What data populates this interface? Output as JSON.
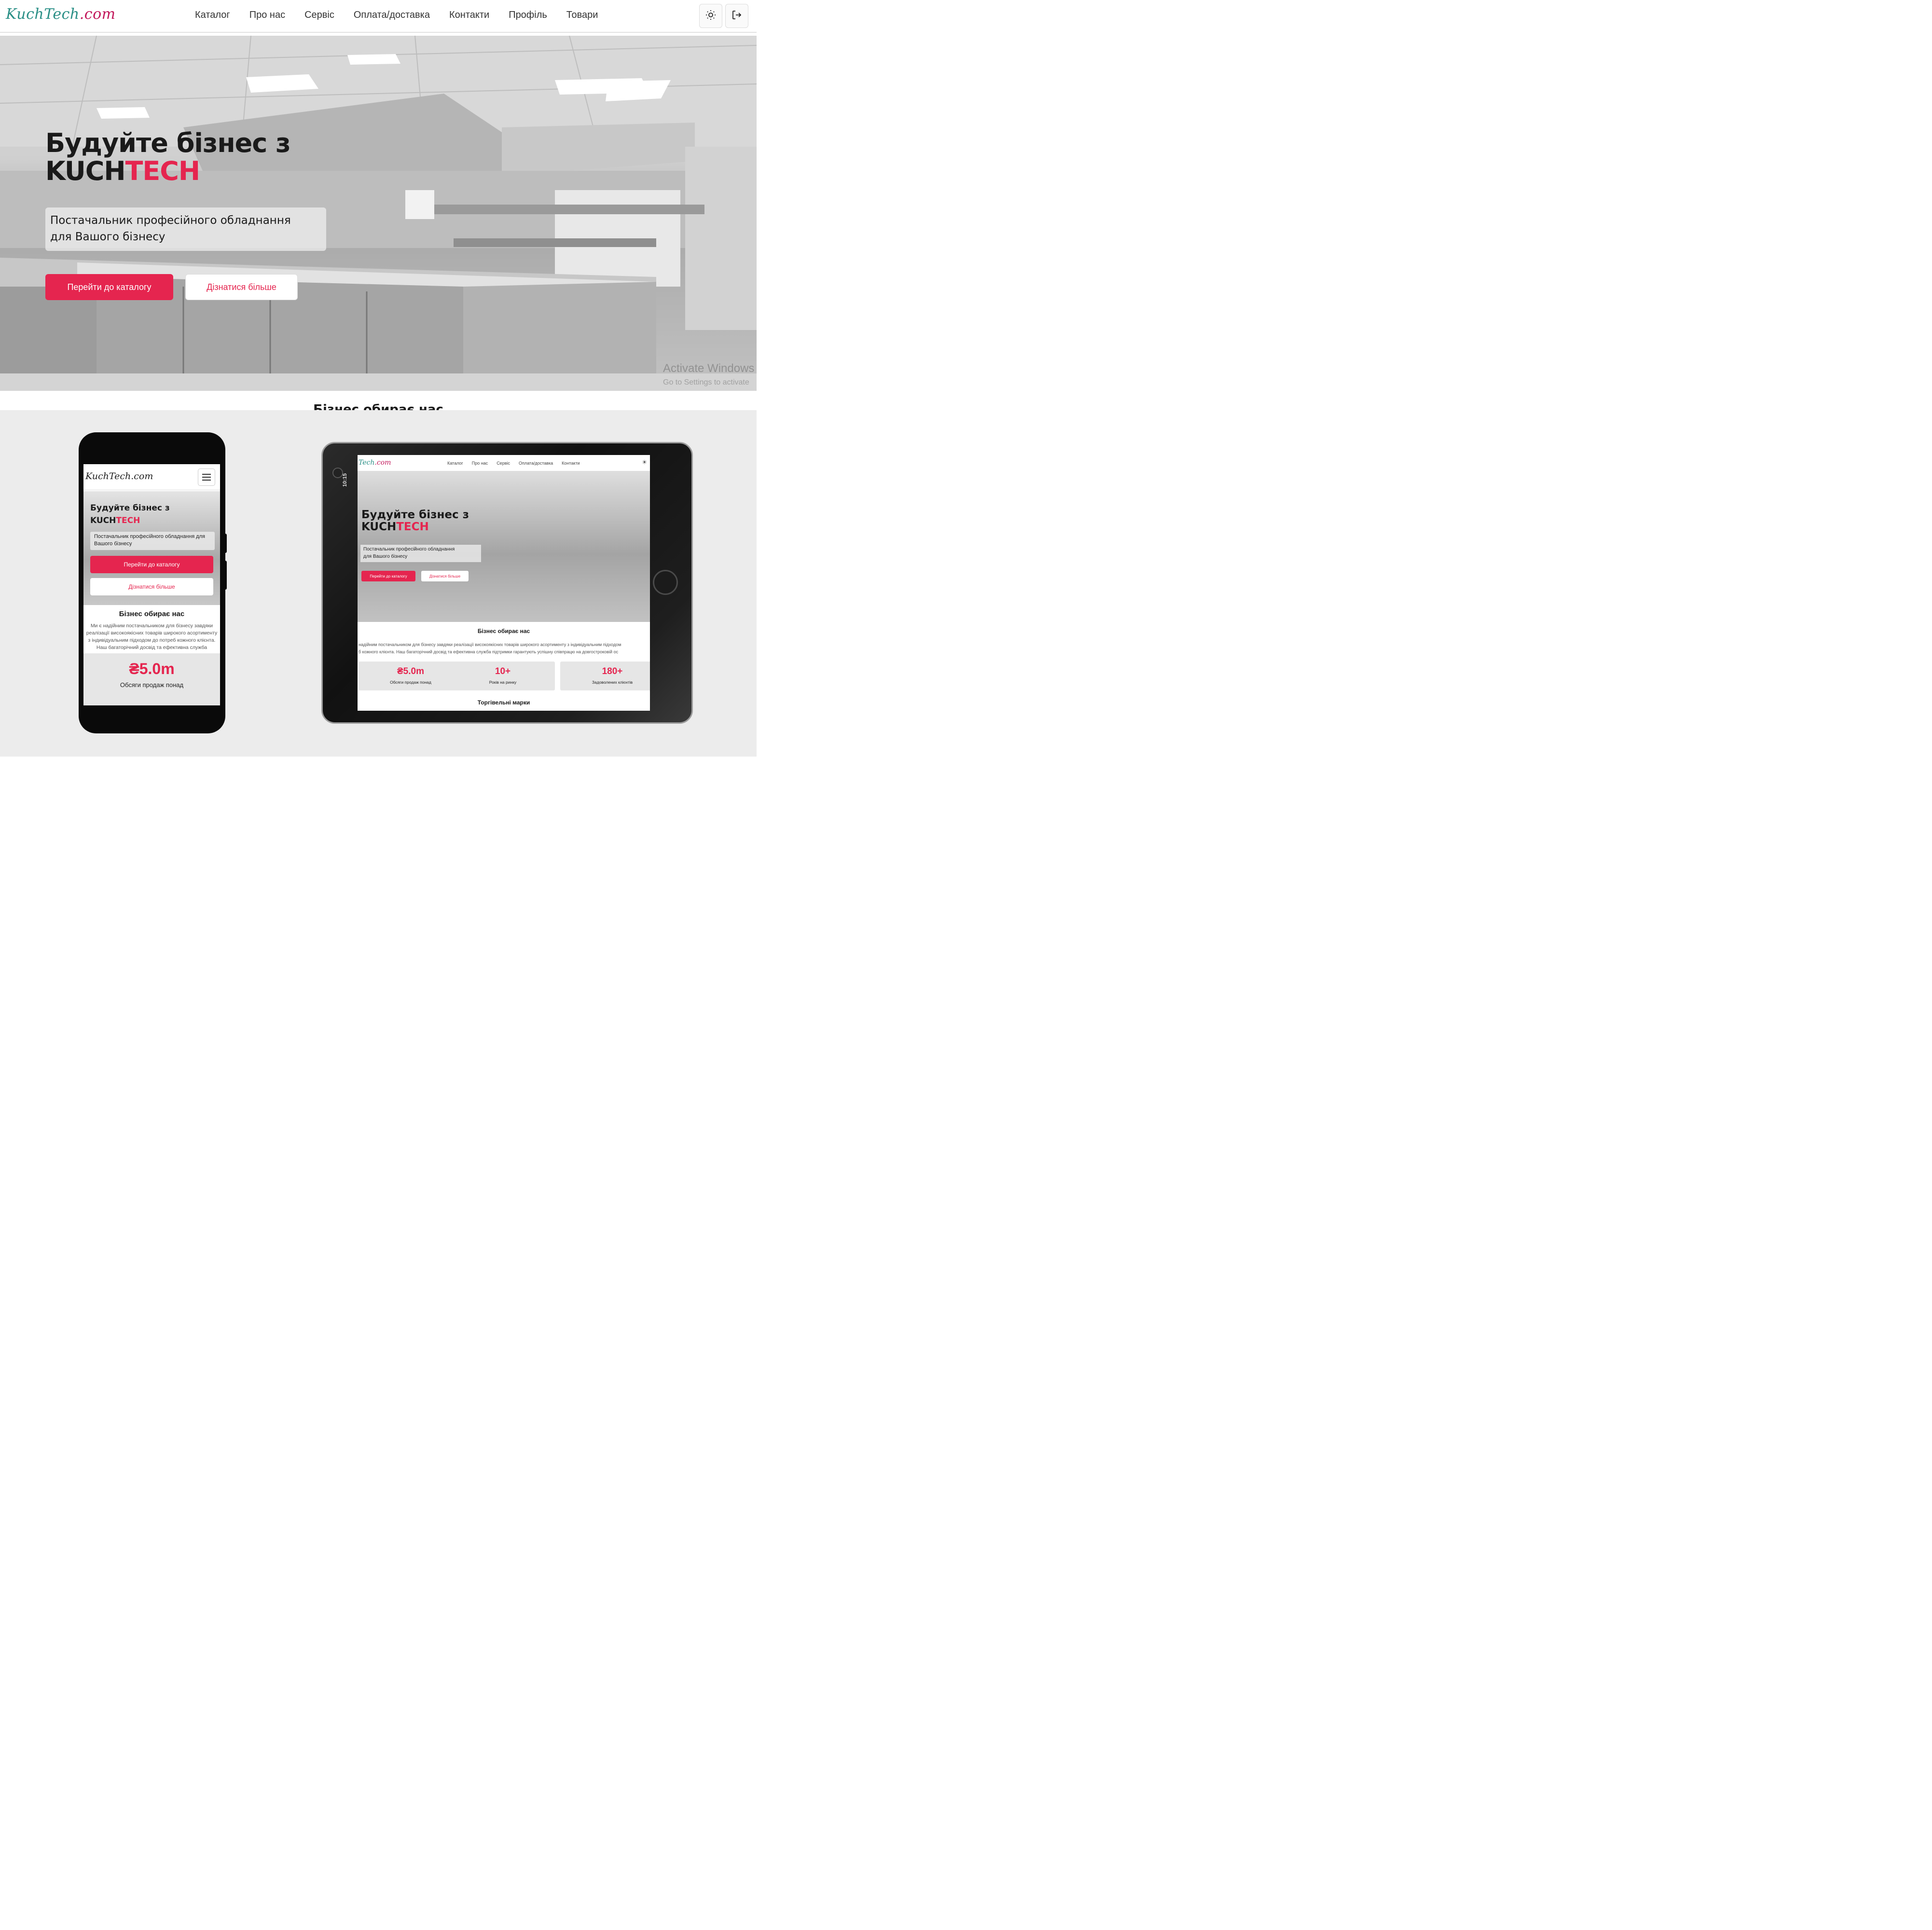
{
  "site": {
    "logo_part1": "KuchTech",
    "logo_part2": ".com",
    "nav": [
      "Каталог",
      "Про нас",
      "Сервіс",
      "Оплата/доставка",
      "Контакти",
      "Профіль",
      "Товари"
    ],
    "icons": {
      "theme": "sun-icon",
      "logout": "logout-icon"
    }
  },
  "hero": {
    "title_line1": "Будуйте бізнес з",
    "title_brand_dark": "KUCH",
    "title_brand_accent": "TECH",
    "subtitle_line1": "Постачальник професійного обладнання",
    "subtitle_line2": "для Вашого бізнесу",
    "primary_button": "Перейти до каталогу",
    "secondary_button": "Дізнатися більше",
    "watermark_line1": "Activate Windows",
    "watermark_line2": "Go to Settings to activate"
  },
  "section_title": "Бізнес обирає нас",
  "colors": {
    "accent": "#e5254f",
    "logo_teal": "#2a8f86",
    "logo_pink": "#c2185b"
  },
  "phone": {
    "logo": "KuchTech.com",
    "title_line1": "Будуйте бізнес з",
    "title_brand_dark": "KUCH",
    "title_brand_accent": "TECH",
    "subtitle": "Постачальник професійного обладнання для Вашого бізнесу",
    "primary_button": "Перейти до каталогу",
    "secondary_button": "Дізнатися більше",
    "section_title": "Бізнес обирає нас",
    "section_text": "Ми є надійним постачальником для бізнесу завдяки реалізації високоякісних товарів широкого асортименту з індивідуальним підходом до потреб кожного клієнта. Наш багаторічний досвід та ефективна служба підтримки гарантують успішну співпрацю на довгостроковій основі.",
    "stat_value": "₴5.0m",
    "stat_label": "Обсяги продаж понад"
  },
  "tablet": {
    "time": "10:15",
    "logo_part1": "Tech",
    "logo_part2": ".com",
    "nav": [
      "Каталог",
      "Про нас",
      "Сервіс",
      "Оплата/доставка",
      "Контакти"
    ],
    "title_line1": "Будуйте бізнес з",
    "title_brand_dark": "KUCH",
    "title_brand_accent": "TECH",
    "subtitle_line1": "Постачальник професійного обладнання",
    "subtitle_line2": "для Вашого бізнесу",
    "primary_button": "Перейти до каталогу",
    "secondary_button": "Дізнатися більше",
    "section_title": "Бізнес обирає нас",
    "section_text_line1": "надійним постачальником для бізнесу завдяки реалізації високоякісних товарів широкого асортименту з індивідуальним підходом",
    "section_text_line2": "б кожного клієнта. Наш багаторічний досвід та ефективна служба підтримки гарантують успішну співпрацю на довгостроковій ос",
    "stats": [
      {
        "value": "₴5.0m",
        "label": "Обсяги продаж понад"
      },
      {
        "value": "10+",
        "label": "Років на ринку"
      },
      {
        "value": "180+",
        "label": "Задоволених клієнтів"
      }
    ],
    "brands_title": "Торгівельні марки"
  }
}
